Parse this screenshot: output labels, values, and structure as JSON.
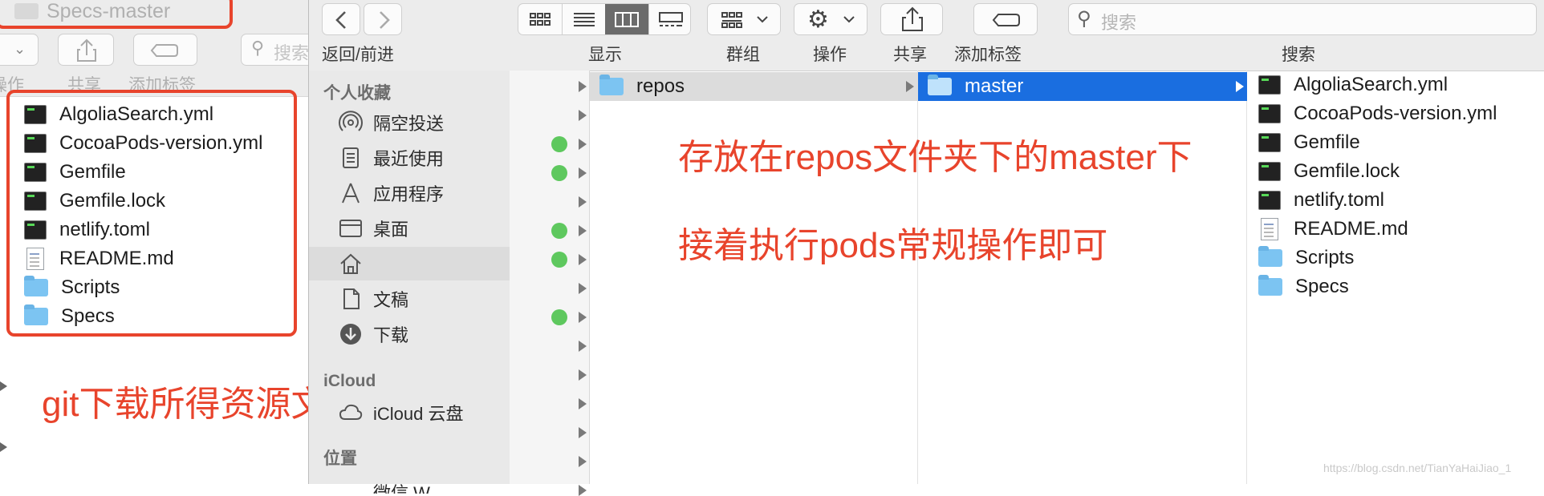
{
  "back_window": {
    "title": "Specs-master",
    "search_placeholder": "搜索",
    "toolbar_labels": {
      "action": "操作",
      "share": "共享",
      "tags": "添加标签"
    },
    "files": [
      {
        "name": "AlgoliaSearch.yml",
        "icon": "exec-file-icon"
      },
      {
        "name": "CocoaPods-version.yml",
        "icon": "exec-file-icon"
      },
      {
        "name": "Gemfile",
        "icon": "exec-file-icon"
      },
      {
        "name": "Gemfile.lock",
        "icon": "exec-file-icon"
      },
      {
        "name": "netlify.toml",
        "icon": "exec-file-icon"
      },
      {
        "name": "README.md",
        "icon": "document-icon"
      },
      {
        "name": "Scripts",
        "icon": "folder-icon"
      },
      {
        "name": "Specs",
        "icon": "folder-icon"
      }
    ]
  },
  "toolbar": {
    "nav_label": "返回/前进",
    "view_label": "显示",
    "group_label": "群组",
    "action_label": "操作",
    "share_label": "共享",
    "tags_label": "添加标签",
    "search_label": "搜索",
    "search_placeholder": "搜索"
  },
  "sidebar": {
    "favorites_heading": "个人收藏",
    "favorites": [
      {
        "label": "隔空投送",
        "icon": "airdrop-icon"
      },
      {
        "label": "最近使用",
        "icon": "recents-icon"
      },
      {
        "label": "应用程序",
        "icon": "applications-icon"
      },
      {
        "label": "桌面",
        "icon": "desktop-icon"
      },
      {
        "label": "",
        "icon": "home-icon"
      },
      {
        "label": "文稿",
        "icon": "documents-icon"
      },
      {
        "label": "下载",
        "icon": "downloads-icon"
      }
    ],
    "icloud_heading": "iCloud",
    "icloud_items": [
      {
        "label": "iCloud 云盘",
        "icon": "cloud-icon"
      }
    ],
    "locations_heading": "位置",
    "locations_partial": "微信 W"
  },
  "columns": {
    "repos_folder": "repos",
    "master_folder": "master",
    "master_files": [
      {
        "name": "AlgoliaSearch.yml",
        "icon": "exec-file-icon"
      },
      {
        "name": "CocoaPods-version.yml",
        "icon": "exec-file-icon"
      },
      {
        "name": "Gemfile",
        "icon": "exec-file-icon"
      },
      {
        "name": "Gemfile.lock",
        "icon": "exec-file-icon"
      },
      {
        "name": "netlify.toml",
        "icon": "exec-file-icon"
      },
      {
        "name": "README.md",
        "icon": "document-icon"
      },
      {
        "name": "Scripts",
        "icon": "folder-icon"
      },
      {
        "name": "Specs",
        "icon": "folder-icon"
      }
    ]
  },
  "annotations": {
    "left_note": "git下载所得资源文件",
    "right_note_1": "存放在repos文件夹下的master下",
    "right_note_2": "接着执行pods常规操作即可"
  },
  "watermark": "https://blog.csdn.net/TianYaHaiJiao_1",
  "colors": {
    "accent": "#1a6ee0",
    "annotation": "#e8442c",
    "tag_green": "#5ec85e",
    "folder": "#7cc4f2"
  }
}
